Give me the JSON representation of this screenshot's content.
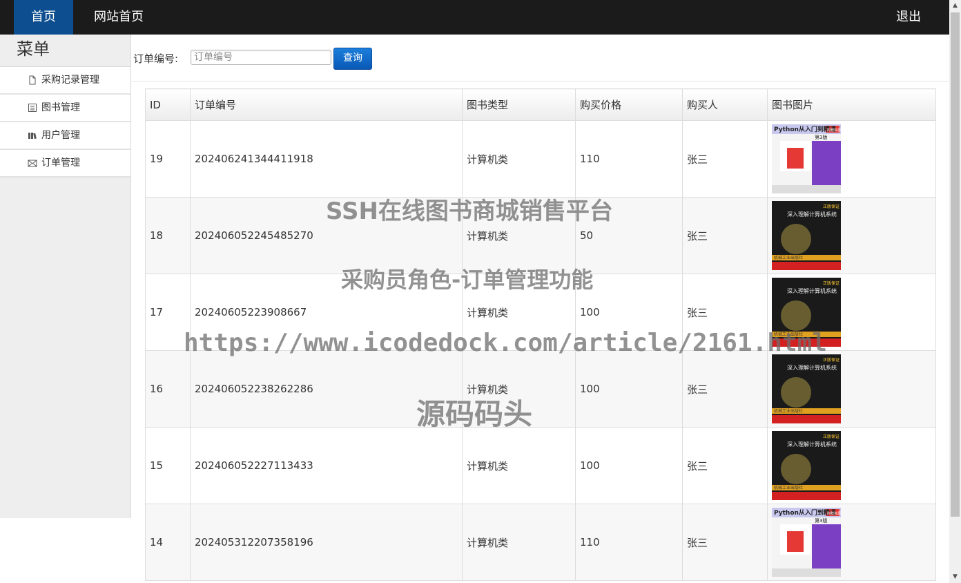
{
  "nav": {
    "home": "首页",
    "site_home": "网站首页",
    "logout": "退出"
  },
  "sidebar": {
    "title": "菜单",
    "items": [
      {
        "label": "采购记录管理",
        "icon": "file-icon"
      },
      {
        "label": "图书管理",
        "icon": "list-icon"
      },
      {
        "label": "用户管理",
        "icon": "books-icon"
      },
      {
        "label": "订单管理",
        "icon": "envelope-icon"
      }
    ]
  },
  "search": {
    "label": "订单编号:",
    "placeholder": "订单编号",
    "button": "查询"
  },
  "table": {
    "headers": [
      "ID",
      "订单编号",
      "图书类型",
      "购买价格",
      "购买人",
      "图书图片"
    ],
    "rows": [
      {
        "id": "19",
        "order_no": "202406241344411918",
        "type": "计算机类",
        "price": "110",
        "buyer": "张三",
        "cover": "python-book"
      },
      {
        "id": "18",
        "order_no": "202406052245485270",
        "type": "计算机类",
        "price": "50",
        "buyer": "张三",
        "cover": "csapp-book"
      },
      {
        "id": "17",
        "order_no": "20240605223908667",
        "type": "计算机类",
        "price": "100",
        "buyer": "张三",
        "cover": "csapp-book"
      },
      {
        "id": "16",
        "order_no": "202406052238262286",
        "type": "计算机类",
        "price": "100",
        "buyer": "张三",
        "cover": "csapp-book"
      },
      {
        "id": "15",
        "order_no": "202406052227113433",
        "type": "计算机类",
        "price": "100",
        "buyer": "张三",
        "cover": "csapp-book"
      },
      {
        "id": "14",
        "order_no": "202405312207358196",
        "type": "计算机类",
        "price": "110",
        "buyer": "张三",
        "cover": "python-book"
      }
    ]
  },
  "watermark": {
    "line1": "SSH在线图书商城销售平台",
    "line2": "采购员角色-订单管理功能",
    "line3": "https://www.icodedock.com/article/2161.html",
    "line4": "源码码头"
  },
  "covers": {
    "python-book": {
      "title": "Python从入门到精通",
      "edition": "第3版",
      "tag": "附赠资源"
    },
    "csapp-book": {
      "title": "深入理解计算机系统",
      "publisher": "机械工业出版社",
      "tag": "正版保证"
    }
  }
}
